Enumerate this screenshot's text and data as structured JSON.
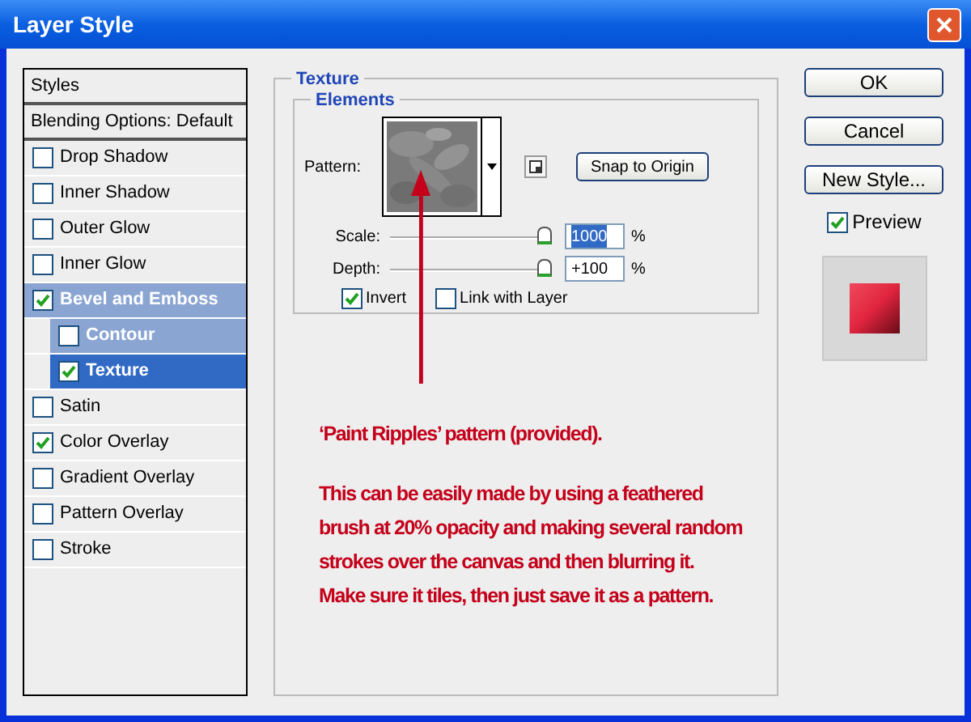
{
  "window": {
    "title": "Layer Style"
  },
  "styles_list": {
    "header": "Styles",
    "blending": "Blending Options: Default",
    "items": [
      {
        "label": "Drop Shadow",
        "checked": false,
        "highlighted": false,
        "selected": false
      },
      {
        "label": "Inner Shadow",
        "checked": false,
        "highlighted": false,
        "selected": false
      },
      {
        "label": "Outer Glow",
        "checked": false,
        "highlighted": false,
        "selected": false
      },
      {
        "label": "Inner Glow",
        "checked": false,
        "highlighted": false,
        "selected": false
      },
      {
        "label": "Bevel and Emboss",
        "checked": true,
        "highlighted": true,
        "selected": false,
        "children": [
          {
            "label": "Contour",
            "checked": false,
            "highlighted": true,
            "selected": false
          },
          {
            "label": "Texture",
            "checked": true,
            "highlighted": false,
            "selected": true
          }
        ]
      },
      {
        "label": "Satin",
        "checked": false,
        "highlighted": false,
        "selected": false
      },
      {
        "label": "Color Overlay",
        "checked": true,
        "highlighted": false,
        "selected": false
      },
      {
        "label": "Gradient Overlay",
        "checked": false,
        "highlighted": false,
        "selected": false
      },
      {
        "label": "Pattern Overlay",
        "checked": false,
        "highlighted": false,
        "selected": false
      },
      {
        "label": "Stroke",
        "checked": false,
        "highlighted": false,
        "selected": false
      }
    ]
  },
  "texture": {
    "title": "Texture",
    "elements_title": "Elements",
    "pattern_label": "Pattern:",
    "snap_button": "Snap to Origin",
    "sliders": [
      {
        "label": "Scale:",
        "level": 1,
        "value": "1000",
        "value_selected": true,
        "unit": "%"
      },
      {
        "label": "Depth:",
        "level": 1,
        "value": "+100",
        "value_selected": false,
        "unit": "%"
      }
    ],
    "checkboxes": [
      {
        "label": "Invert",
        "checked": true
      },
      {
        "label": "Link with Layer",
        "checked": false
      }
    ]
  },
  "buttons": [
    "OK",
    "Cancel",
    "New Style..."
  ],
  "preview": {
    "label": "Preview",
    "checked": true
  },
  "annotation": {
    "title": "‘Paint Ripples’ pattern (provided).",
    "body": "This can be easily made by using a feathered brush at 20% opacity and making several random strokes over the canvas and then blurring it. Make sure it tiles, then just save it as a pattern."
  }
}
